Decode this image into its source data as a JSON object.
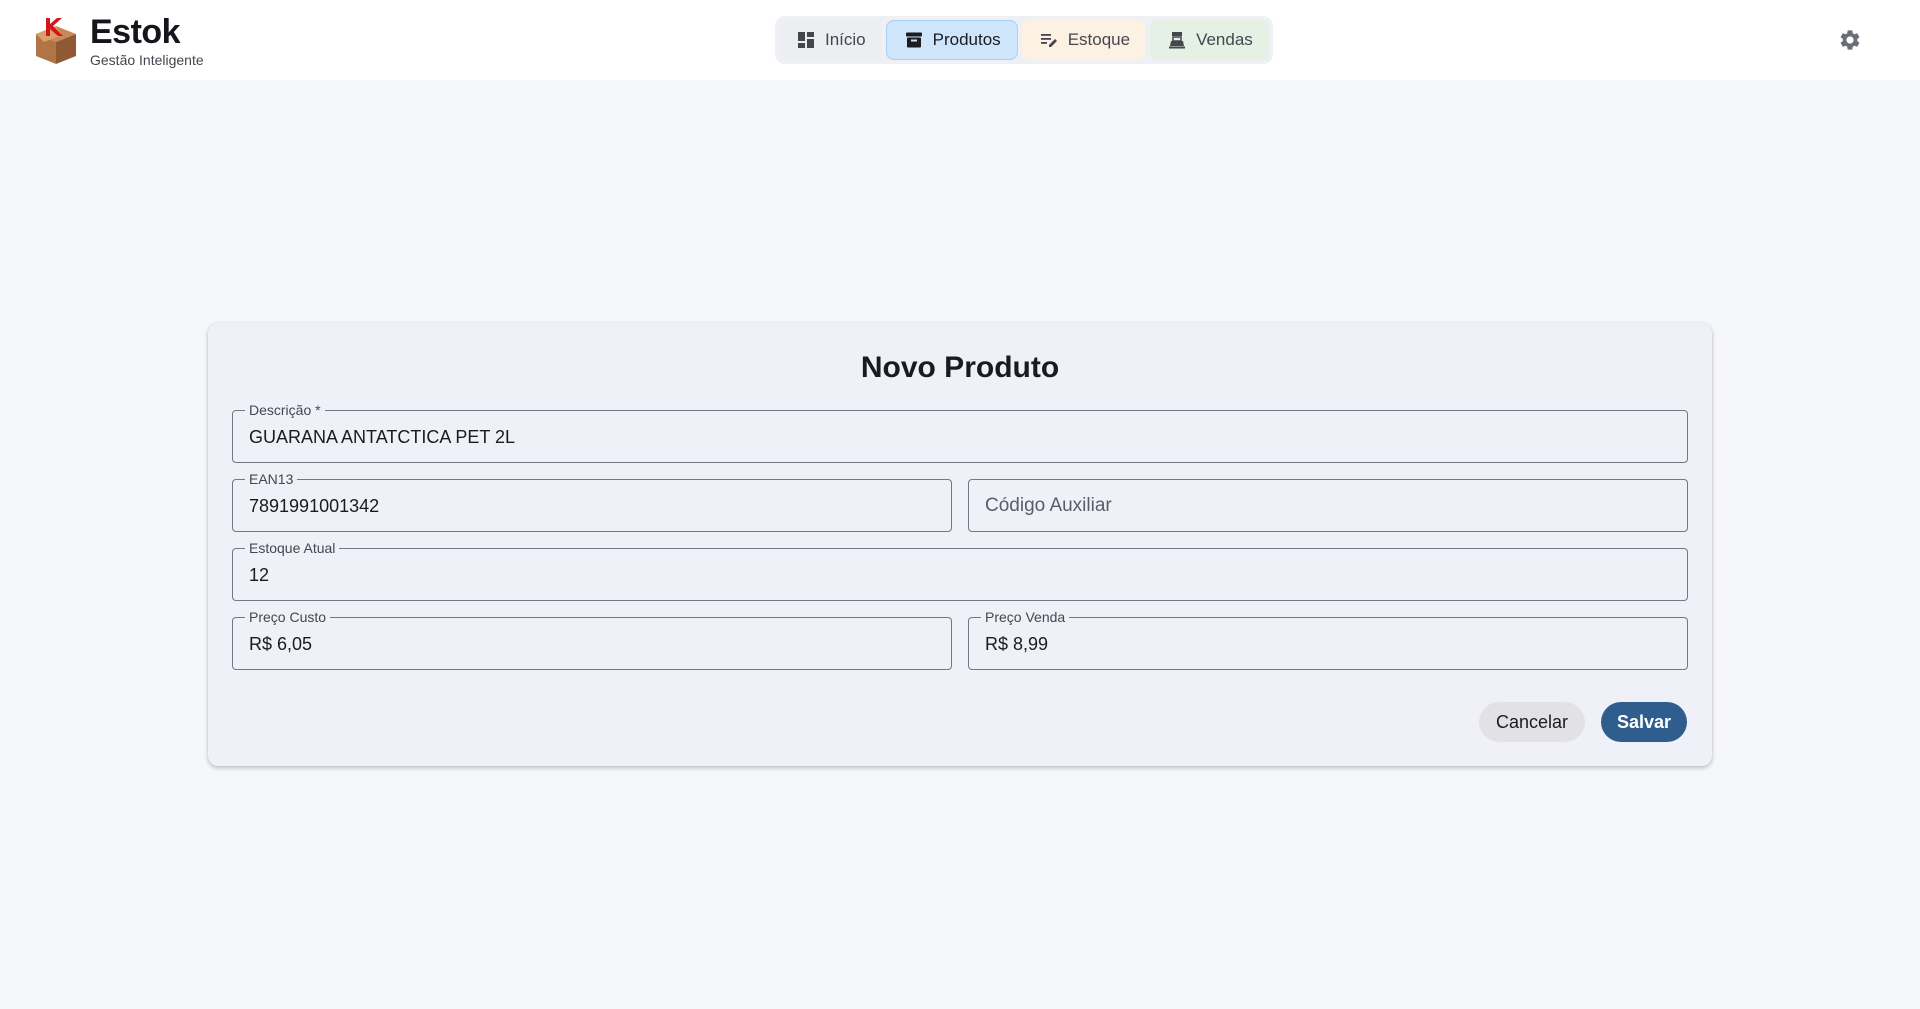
{
  "header": {
    "brand_name": "Estok",
    "brand_tagline": "Gestão Inteligente",
    "nav": {
      "home_label": "Início",
      "products_label": "Produtos",
      "stock_label": "Estoque",
      "sales_label": "Vendas",
      "active": "Produtos"
    },
    "settings_icon": "gear-icon"
  },
  "form": {
    "title": "Novo Produto",
    "description": {
      "label": "Descrição *",
      "value": "GUARANA ANTATCTICA PET 2L"
    },
    "ean13": {
      "label": "EAN13",
      "value": "7891991001342"
    },
    "aux_code": {
      "placeholder": "Código Auxiliar",
      "value": ""
    },
    "current_stock": {
      "label": "Estoque Atual",
      "value": "12"
    },
    "cost_price": {
      "label": "Preço Custo",
      "value": "R$ 6,05"
    },
    "sale_price": {
      "label": "Preço Venda",
      "value": "R$ 8,99"
    },
    "cancel_label": "Cancelar",
    "save_label": "Salvar"
  },
  "colors": {
    "primary": "#2f5e8e",
    "active_tab": "#cfe5fb",
    "stock_tab": "#fcf1e2",
    "sales_tab": "#e4f1e4",
    "background": "#f6f7fb",
    "card": "#f0f1f8"
  }
}
